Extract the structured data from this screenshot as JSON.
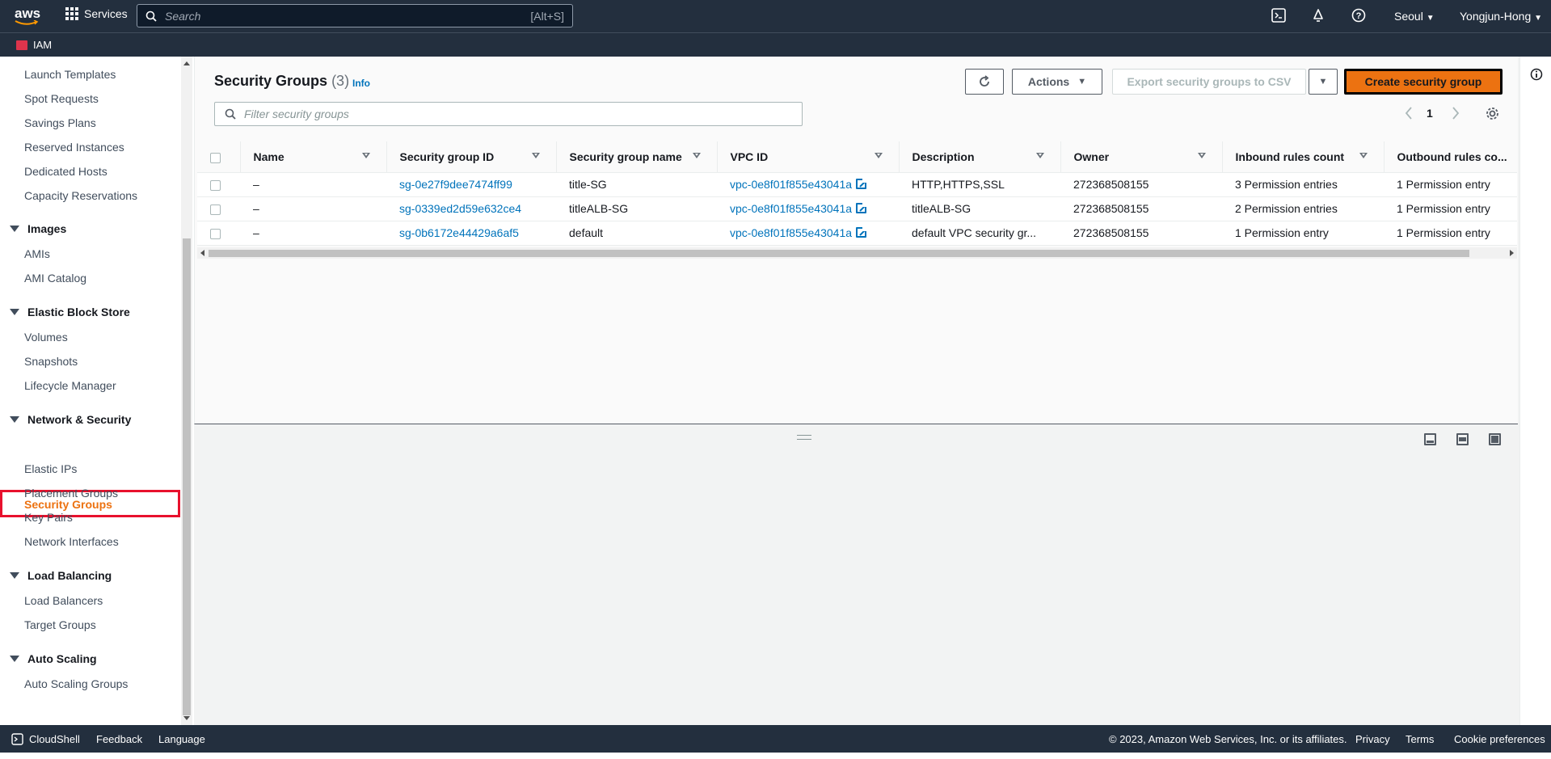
{
  "topnav": {
    "logo": "aws",
    "services": "Services",
    "search_placeholder": "Search",
    "search_shortcut": "[Alt+S]",
    "region": "Seoul",
    "user": "Yongjun-Hong"
  },
  "subnav": {
    "service": "IAM"
  },
  "sidebar": {
    "items_top": [
      "Launch Templates",
      "Spot Requests",
      "Savings Plans",
      "Reserved Instances",
      "Dedicated Hosts",
      "Capacity Reservations"
    ],
    "images": {
      "title": "Images",
      "items": [
        "AMIs",
        "AMI Catalog"
      ]
    },
    "ebs": {
      "title": "Elastic Block Store",
      "items": [
        "Volumes",
        "Snapshots",
        "Lifecycle Manager"
      ]
    },
    "netsec": {
      "title": "Network & Security",
      "active": "Security Groups",
      "items": [
        "Elastic IPs",
        "Placement Groups",
        "Key Pairs",
        "Network Interfaces"
      ]
    },
    "lb": {
      "title": "Load Balancing",
      "items": [
        "Load Balancers",
        "Target Groups"
      ]
    },
    "as": {
      "title": "Auto Scaling",
      "items": [
        "Auto Scaling Groups"
      ]
    }
  },
  "main": {
    "title": "Security Groups",
    "count": "(3)",
    "info": "Info",
    "actions": "Actions",
    "export": "Export security groups to CSV",
    "create": "Create security group",
    "filter_placeholder": "Filter security groups",
    "page": "1"
  },
  "table": {
    "headers": [
      "Name",
      "Security group ID",
      "Security group name",
      "VPC ID",
      "Description",
      "Owner",
      "Inbound rules count",
      "Outbound rules co..."
    ],
    "rows": [
      {
        "name": "–",
        "id": "sg-0e27f9dee7474ff99",
        "sgname": "title-SG",
        "vpc": "vpc-0e8f01f855e43041a",
        "desc": "HTTP,HTTPS,SSL",
        "owner": "272368508155",
        "inbound": "3 Permission entries",
        "outbound": "1 Permission entry"
      },
      {
        "name": "–",
        "id": "sg-0339ed2d59e632ce4",
        "sgname": "titleALB-SG",
        "vpc": "vpc-0e8f01f855e43041a",
        "desc": "titleALB-SG",
        "owner": "272368508155",
        "inbound": "2 Permission entries",
        "outbound": "1 Permission entry"
      },
      {
        "name": "–",
        "id": "sg-0b6172e44429a6af5",
        "sgname": "default",
        "vpc": "vpc-0e8f01f855e43041a",
        "desc": "default VPC security gr...",
        "owner": "272368508155",
        "inbound": "1 Permission entry",
        "outbound": "1 Permission entry"
      }
    ]
  },
  "footer": {
    "cloudshell": "CloudShell",
    "feedback": "Feedback",
    "language": "Language",
    "copyright": "© 2023, Amazon Web Services, Inc. or its affiliates.",
    "privacy": "Privacy",
    "terms": "Terms",
    "cookies": "Cookie preferences"
  },
  "colors": {
    "nav": "#232f3e",
    "accent": "#ec7211",
    "link": "#0073bb",
    "highlight": "#e8112d"
  }
}
